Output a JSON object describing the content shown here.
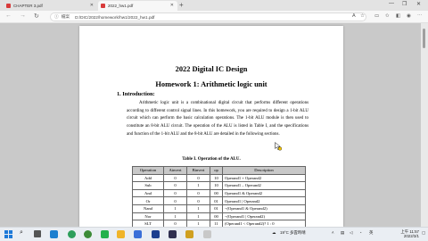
{
  "browser": {
    "tabs": [
      {
        "label": "CHAPTER 3.pdf",
        "active": false
      },
      {
        "label": "2022_hw1.pdf",
        "active": true
      }
    ],
    "address_label": "檔案",
    "address": "D:/DIC/2022/homework/hw1/2022_hw1.pdf"
  },
  "document": {
    "title": "2022 Digital IC Design",
    "subtitle": "Homework 1: Arithmetic logic unit",
    "section_heading": "1.  Introduction:",
    "paragraph": "Arithmetic logic unit is a combinational digital circuit that performs different operations according to different control signal lines. In this homework, you are required to design a 1-bit ALU circuit which can perform the basic calculation operations. The 1-bit ALU module is then used to constitute an 8-bit ALU circuit. The operation of the ALU is listed in Table I, and the specifications and function of the 1-bit ALU and the 8-bit ALU are detailed in the following sections.",
    "table_caption": "Table I. Operation of the ALU.",
    "table": {
      "headers": [
        "Operation",
        "Ainvert",
        "Binvert",
        "op",
        "Description"
      ],
      "rows": [
        [
          "Add",
          "0",
          "0",
          "10",
          "Operand1 + Operand2"
        ],
        [
          "Sub",
          "0",
          "1",
          "10",
          "Operand1 – Operand2"
        ],
        [
          "And",
          "0",
          "0",
          "00",
          "Operand1 & Operand2"
        ],
        [
          "Or",
          "0",
          "0",
          "01",
          "Operand1 | Operand2"
        ],
        [
          "Nand",
          "1",
          "1",
          "01",
          "~(Operand1 & Operand2)"
        ],
        [
          "Nor",
          "1",
          "1",
          "00",
          "~(Operand1 | Operand2)"
        ],
        [
          "SLT",
          "0",
          "1",
          "11",
          "(Operand1 < Operand2)? 1 : 0"
        ]
      ]
    }
  },
  "taskbar": {
    "weather": "19°C 多雲時晴",
    "ime": "英",
    "time": "上午 11:57",
    "date": "2022/3/1"
  }
}
